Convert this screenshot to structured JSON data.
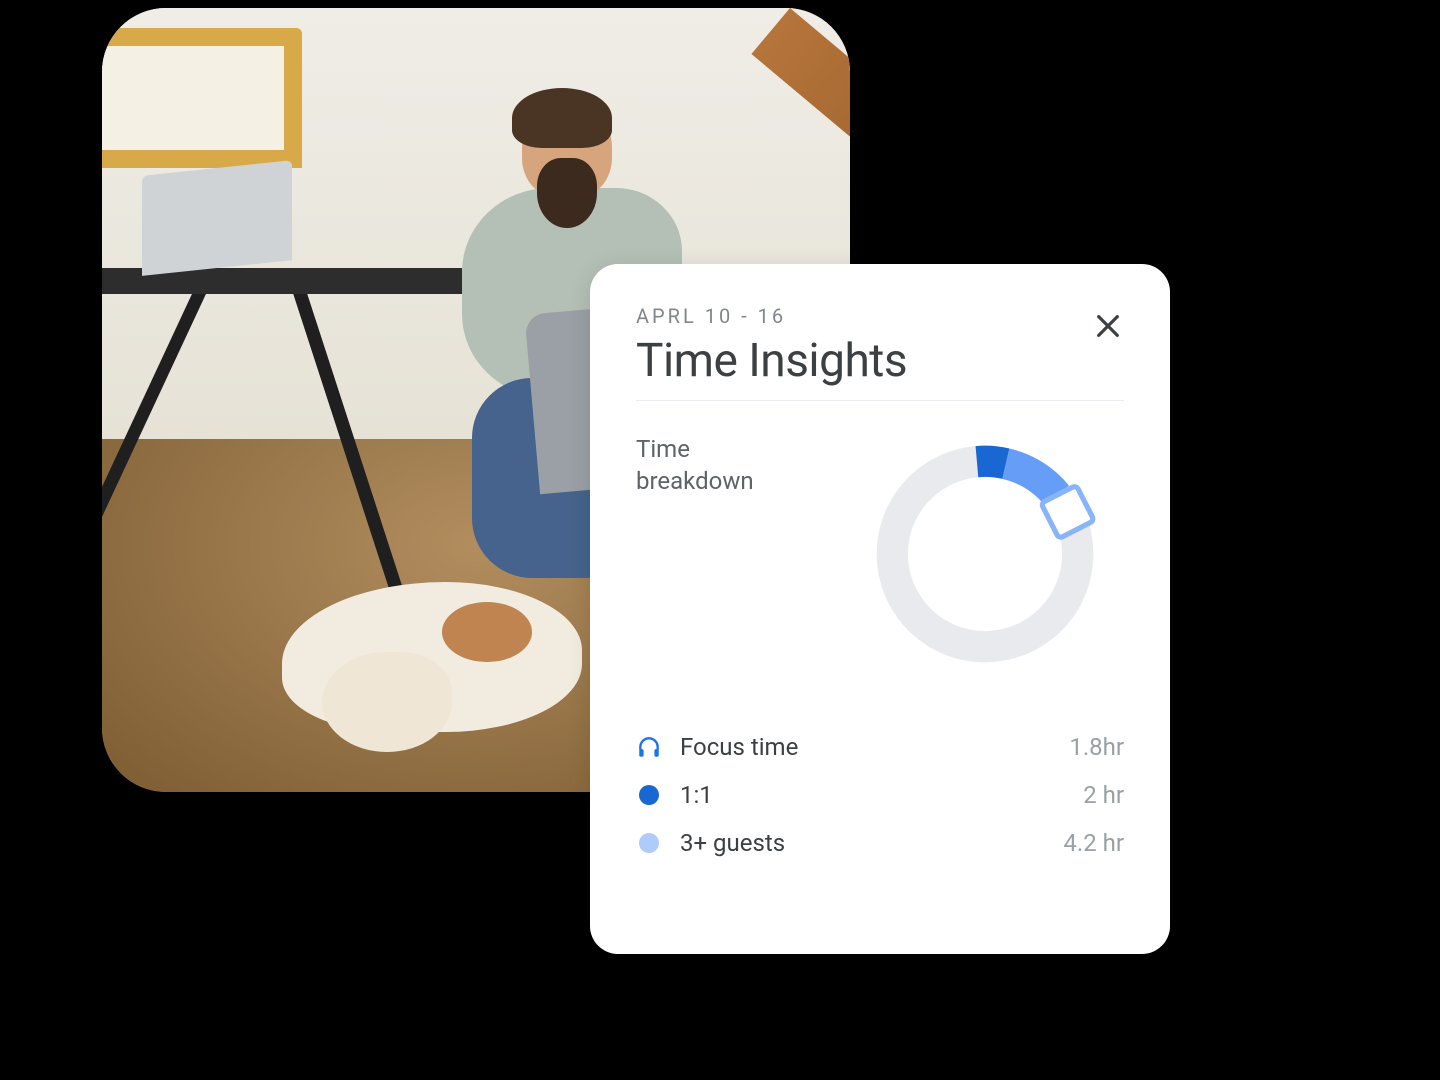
{
  "card": {
    "date_range": "APRL 10 - 16",
    "title": "Time Insights",
    "section_label": "Time breakdown"
  },
  "legend": {
    "focus": {
      "label": "Focus time",
      "value": "1.8hr",
      "color": "#1a73e8"
    },
    "one_on_one": {
      "label": "1:1",
      "value": "2 hr",
      "color": "#1967d2"
    },
    "guests": {
      "label": "3+ guests",
      "value": "4.2 hr",
      "color": "#aecbfa"
    }
  },
  "chart_data": {
    "type": "pie",
    "title": "Time breakdown",
    "series": [
      {
        "name": "1:1",
        "value": 2.0,
        "color": "#1967d2"
      },
      {
        "name": "3+ guests",
        "value": 4.2,
        "color": "#669df6"
      },
      {
        "name": "Focus time",
        "value": 1.8,
        "color": "#d2e3fc"
      },
      {
        "name": "Remaining",
        "value": 32.0,
        "color": "#e8eaed"
      }
    ],
    "total_hours_basis": 40,
    "donut": true,
    "start_angle_deg": -5
  }
}
